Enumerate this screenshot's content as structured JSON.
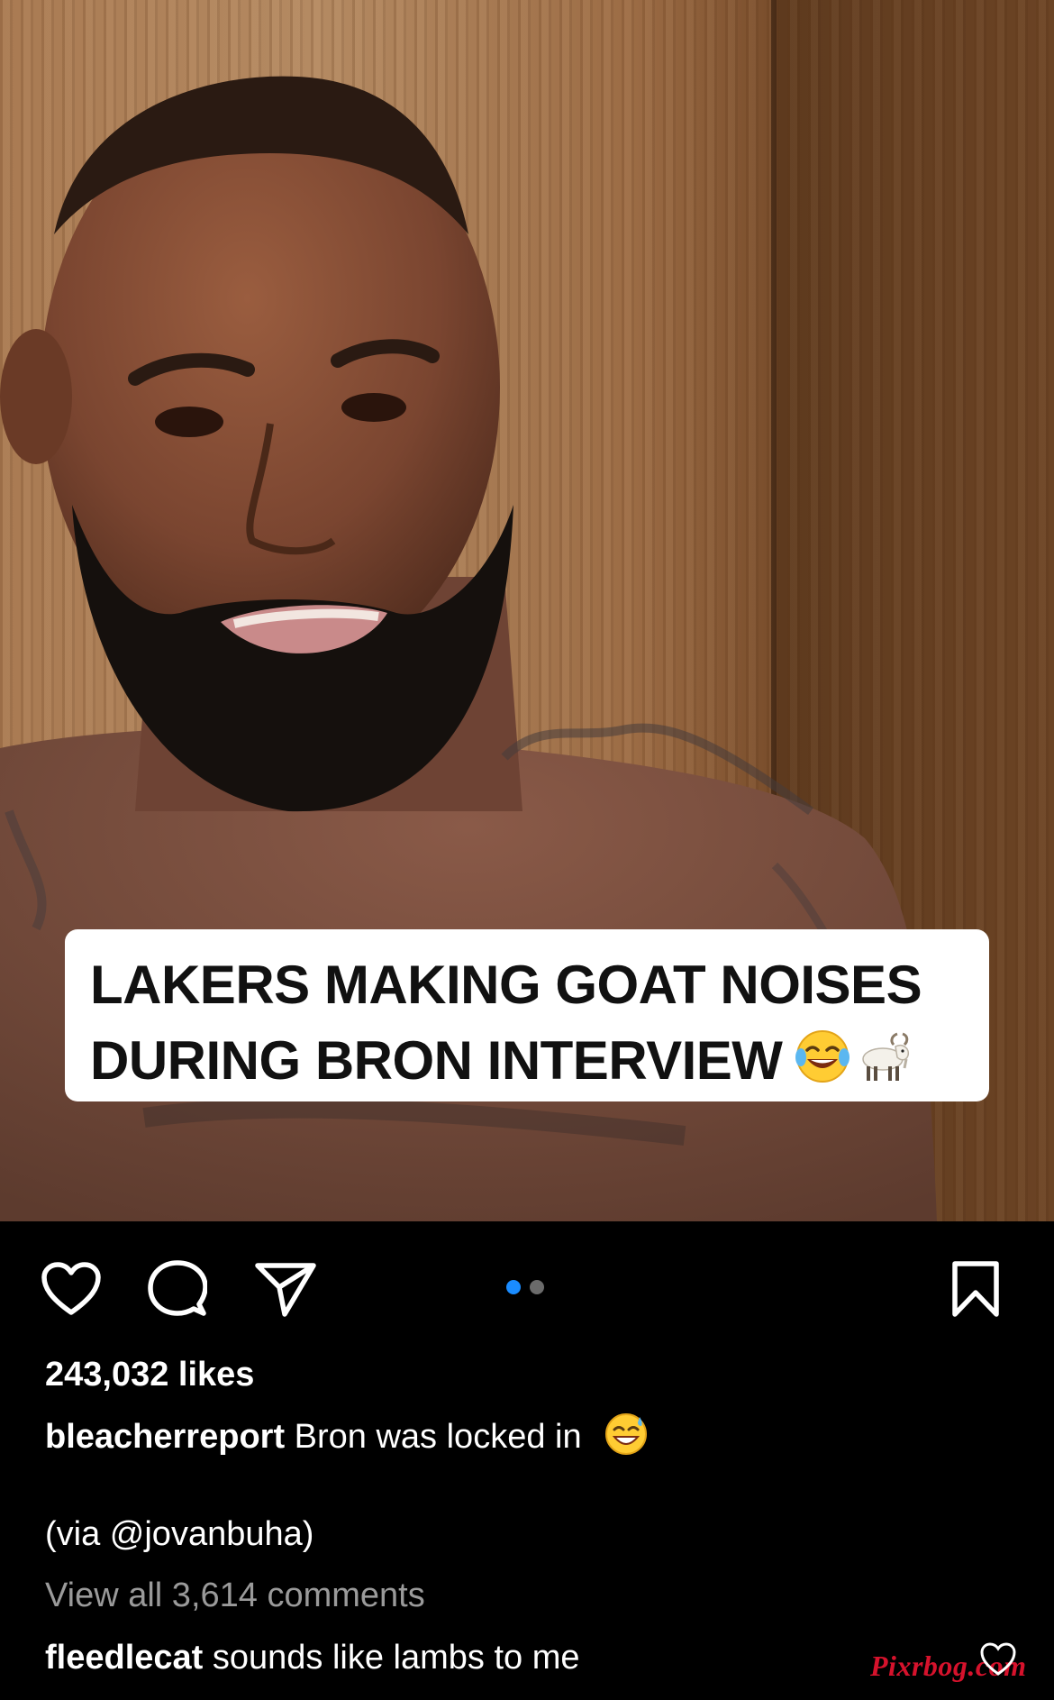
{
  "media": {
    "overlay_lines": [
      "LAKERS MAKING GOAT NOISES",
      "DURING BRON INTERVIEW"
    ],
    "overlay_emojis": [
      "tears-of-joy-emoji",
      "goat-emoji"
    ],
    "carousel": {
      "count": 2,
      "active_index": 0
    }
  },
  "actions": {
    "like_icon": "heart-icon",
    "comment_icon": "comment-bubble-icon",
    "share_icon": "paper-plane-icon",
    "save_icon": "bookmark-icon"
  },
  "post": {
    "likes": "243,032 likes",
    "username": "bleacherreport",
    "caption": "Bron was locked in",
    "caption_emoji": "grinning-sweat-emoji",
    "via": "(via @jovanbuha)",
    "view_comments": "View all 3,614 comments"
  },
  "comment": {
    "username": "fleedlecat",
    "text": "sounds like lambs to me"
  },
  "watermark": "Pixrbog.com",
  "colors": {
    "background": "#000000",
    "accent_dot": "#1a8cff",
    "muted_text": "#9a9a9a",
    "watermark": "#d6122c"
  }
}
